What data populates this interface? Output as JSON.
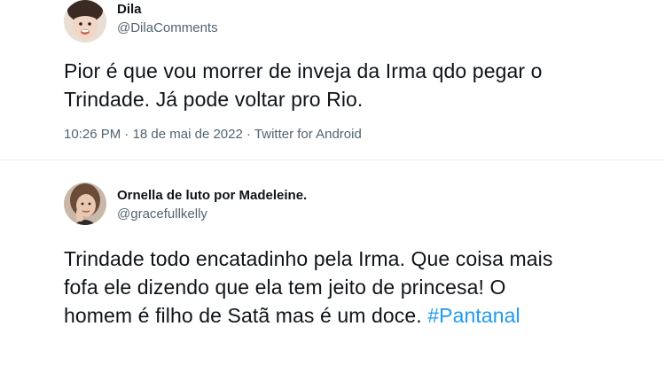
{
  "tweets": [
    {
      "author_name": "Dila",
      "author_handle": "@DilaComments",
      "text_line1": "Pior é que vou morrer de inveja da Irma qdo pegar o",
      "text_line2": "Trindade. Já pode voltar pro Rio.",
      "time": "10:26 PM",
      "separator": "·",
      "date": "18 de mai de 2022",
      "source": "Twitter for Android"
    },
    {
      "author_name": "Ornella de luto por Madeleine.",
      "author_handle": "@gracefullkelly",
      "text_line1": "Trindade todo encatadinho pela Irma. Que coisa mais",
      "text_line2": "fofa ele dizendo que ela tem jeito de princesa! O",
      "text_line3": "homem é filho de Satã mas é um doce.",
      "hashtag": "#Pantanal"
    }
  ],
  "colors": {
    "text": "#0f1419",
    "secondary": "#536471",
    "link": "#1d9bf0",
    "divider": "#e6e9ec"
  }
}
